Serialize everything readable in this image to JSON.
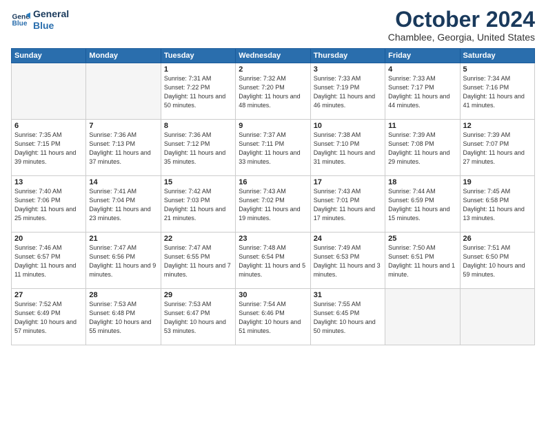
{
  "header": {
    "logo_line1": "General",
    "logo_line2": "Blue",
    "month": "October 2024",
    "location": "Chamblee, Georgia, United States"
  },
  "weekdays": [
    "Sunday",
    "Monday",
    "Tuesday",
    "Wednesday",
    "Thursday",
    "Friday",
    "Saturday"
  ],
  "weeks": [
    [
      {
        "day": "",
        "empty": true
      },
      {
        "day": "",
        "empty": true
      },
      {
        "day": "1",
        "sunrise": "7:31 AM",
        "sunset": "7:22 PM",
        "daylight": "11 hours and 50 minutes."
      },
      {
        "day": "2",
        "sunrise": "7:32 AM",
        "sunset": "7:20 PM",
        "daylight": "11 hours and 48 minutes."
      },
      {
        "day": "3",
        "sunrise": "7:33 AM",
        "sunset": "7:19 PM",
        "daylight": "11 hours and 46 minutes."
      },
      {
        "day": "4",
        "sunrise": "7:33 AM",
        "sunset": "7:17 PM",
        "daylight": "11 hours and 44 minutes."
      },
      {
        "day": "5",
        "sunrise": "7:34 AM",
        "sunset": "7:16 PM",
        "daylight": "11 hours and 41 minutes."
      }
    ],
    [
      {
        "day": "6",
        "sunrise": "7:35 AM",
        "sunset": "7:15 PM",
        "daylight": "11 hours and 39 minutes."
      },
      {
        "day": "7",
        "sunrise": "7:36 AM",
        "sunset": "7:13 PM",
        "daylight": "11 hours and 37 minutes."
      },
      {
        "day": "8",
        "sunrise": "7:36 AM",
        "sunset": "7:12 PM",
        "daylight": "11 hours and 35 minutes."
      },
      {
        "day": "9",
        "sunrise": "7:37 AM",
        "sunset": "7:11 PM",
        "daylight": "11 hours and 33 minutes."
      },
      {
        "day": "10",
        "sunrise": "7:38 AM",
        "sunset": "7:10 PM",
        "daylight": "11 hours and 31 minutes."
      },
      {
        "day": "11",
        "sunrise": "7:39 AM",
        "sunset": "7:08 PM",
        "daylight": "11 hours and 29 minutes."
      },
      {
        "day": "12",
        "sunrise": "7:39 AM",
        "sunset": "7:07 PM",
        "daylight": "11 hours and 27 minutes."
      }
    ],
    [
      {
        "day": "13",
        "sunrise": "7:40 AM",
        "sunset": "7:06 PM",
        "daylight": "11 hours and 25 minutes."
      },
      {
        "day": "14",
        "sunrise": "7:41 AM",
        "sunset": "7:04 PM",
        "daylight": "11 hours and 23 minutes."
      },
      {
        "day": "15",
        "sunrise": "7:42 AM",
        "sunset": "7:03 PM",
        "daylight": "11 hours and 21 minutes."
      },
      {
        "day": "16",
        "sunrise": "7:43 AM",
        "sunset": "7:02 PM",
        "daylight": "11 hours and 19 minutes."
      },
      {
        "day": "17",
        "sunrise": "7:43 AM",
        "sunset": "7:01 PM",
        "daylight": "11 hours and 17 minutes."
      },
      {
        "day": "18",
        "sunrise": "7:44 AM",
        "sunset": "6:59 PM",
        "daylight": "11 hours and 15 minutes."
      },
      {
        "day": "19",
        "sunrise": "7:45 AM",
        "sunset": "6:58 PM",
        "daylight": "11 hours and 13 minutes."
      }
    ],
    [
      {
        "day": "20",
        "sunrise": "7:46 AM",
        "sunset": "6:57 PM",
        "daylight": "11 hours and 11 minutes."
      },
      {
        "day": "21",
        "sunrise": "7:47 AM",
        "sunset": "6:56 PM",
        "daylight": "11 hours and 9 minutes."
      },
      {
        "day": "22",
        "sunrise": "7:47 AM",
        "sunset": "6:55 PM",
        "daylight": "11 hours and 7 minutes."
      },
      {
        "day": "23",
        "sunrise": "7:48 AM",
        "sunset": "6:54 PM",
        "daylight": "11 hours and 5 minutes."
      },
      {
        "day": "24",
        "sunrise": "7:49 AM",
        "sunset": "6:53 PM",
        "daylight": "11 hours and 3 minutes."
      },
      {
        "day": "25",
        "sunrise": "7:50 AM",
        "sunset": "6:51 PM",
        "daylight": "11 hours and 1 minute."
      },
      {
        "day": "26",
        "sunrise": "7:51 AM",
        "sunset": "6:50 PM",
        "daylight": "10 hours and 59 minutes."
      }
    ],
    [
      {
        "day": "27",
        "sunrise": "7:52 AM",
        "sunset": "6:49 PM",
        "daylight": "10 hours and 57 minutes."
      },
      {
        "day": "28",
        "sunrise": "7:53 AM",
        "sunset": "6:48 PM",
        "daylight": "10 hours and 55 minutes."
      },
      {
        "day": "29",
        "sunrise": "7:53 AM",
        "sunset": "6:47 PM",
        "daylight": "10 hours and 53 minutes."
      },
      {
        "day": "30",
        "sunrise": "7:54 AM",
        "sunset": "6:46 PM",
        "daylight": "10 hours and 51 minutes."
      },
      {
        "day": "31",
        "sunrise": "7:55 AM",
        "sunset": "6:45 PM",
        "daylight": "10 hours and 50 minutes."
      },
      {
        "day": "",
        "empty": true
      },
      {
        "day": "",
        "empty": true
      }
    ]
  ]
}
